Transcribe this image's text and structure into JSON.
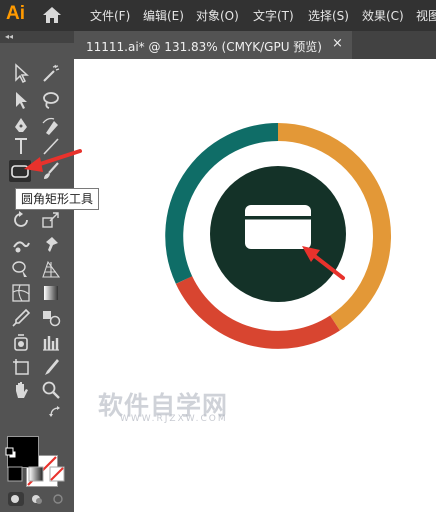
{
  "app": {
    "logo": "Ai"
  },
  "menu": [
    "文件(F)",
    "编辑(E)",
    "对象(O)",
    "文字(T)",
    "选择(S)",
    "效果(C)",
    "视图"
  ],
  "document_tab": {
    "title": "11111.ai* @ 131.83% (CMYK/GPU 预览)",
    "close": "×"
  },
  "tooltip": {
    "text": "圆角矩形工具"
  },
  "toolbar": {
    "collapse": "◂◂"
  },
  "watermark": {
    "main": "软件自学网",
    "sub": "WWW.RJZXW.COM"
  },
  "colors": {
    "ring_teal": "#0f6d67",
    "ring_orange": "#e39837",
    "ring_red": "#d84530",
    "center_dark": "#143228",
    "arrow_red": "#e8322c",
    "ai_orange": "#ff9a00"
  },
  "icons": [
    "home-icon",
    "selection-tool-icon",
    "direct-selection-tool-icon",
    "magic-wand-icon",
    "lasso-icon",
    "pen-tool-icon",
    "curvature-tool-icon",
    "type-tool-icon",
    "line-segment-tool-icon",
    "rounded-rectangle-tool-icon",
    "paintbrush-icon",
    "rotate-tool-icon",
    "scale-tool-icon",
    "eyedropper-icon",
    "hand-tool-icon",
    "zoom-tool-icon",
    "card-icon"
  ]
}
